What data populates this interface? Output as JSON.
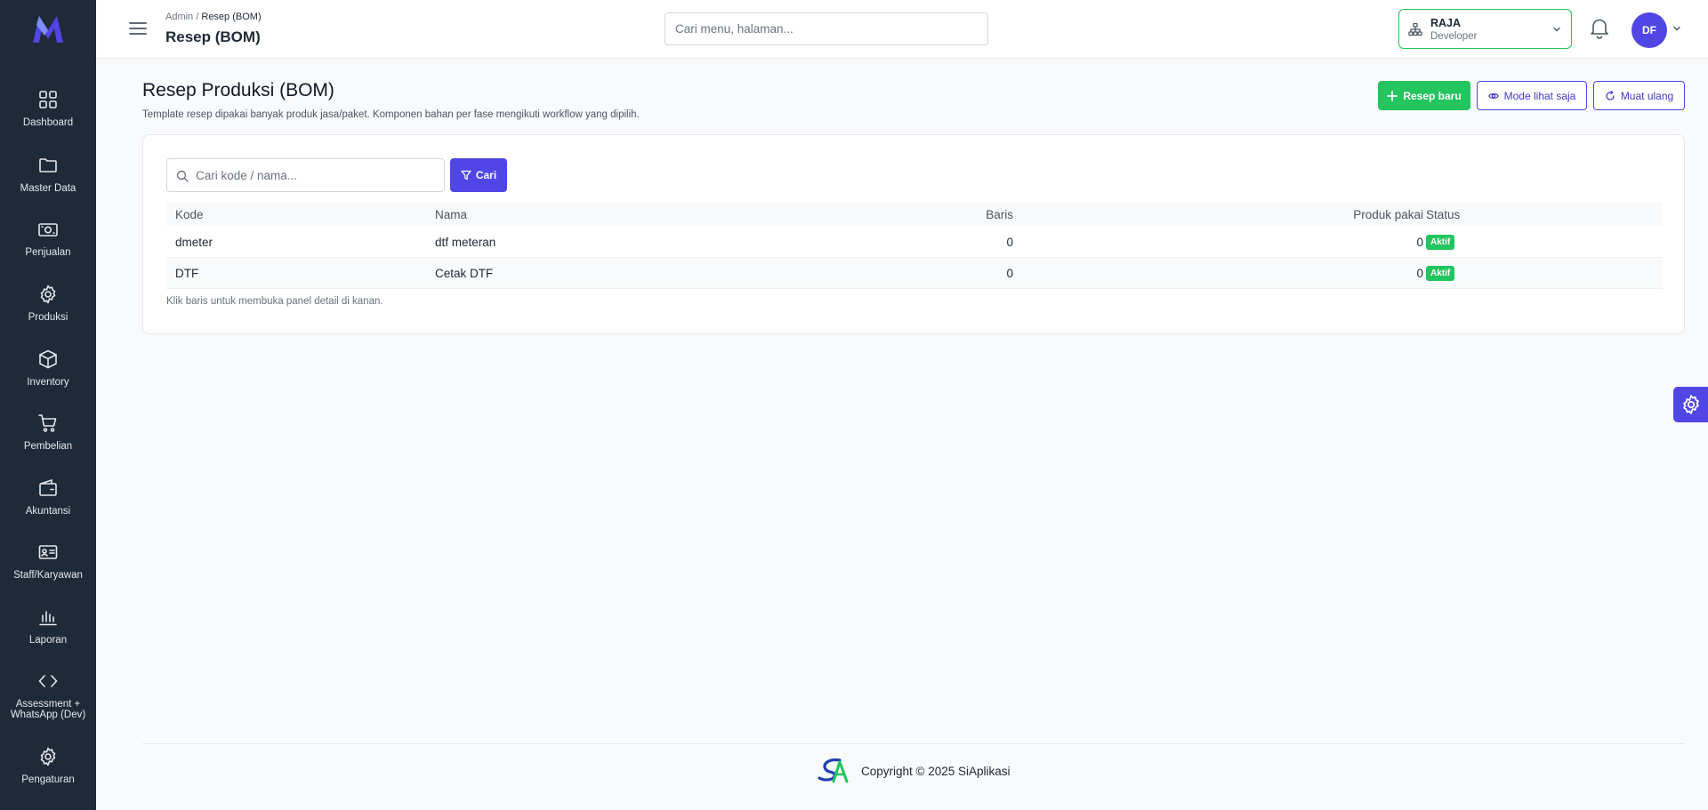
{
  "sidebar": {
    "items": [
      {
        "label": "Dashboard",
        "icon": "grid-icon"
      },
      {
        "label": "Master Data",
        "icon": "folder-icon"
      },
      {
        "label": "Penjualan",
        "icon": "cash-icon"
      },
      {
        "label": "Produksi",
        "icon": "gear-icon"
      },
      {
        "label": "Inventory",
        "icon": "box-icon"
      },
      {
        "label": "Pembelian",
        "icon": "cart-icon"
      },
      {
        "label": "Akuntansi",
        "icon": "wallet-icon"
      },
      {
        "label": "Staff/Karyawan",
        "icon": "id-card-icon"
      },
      {
        "label": "Laporan",
        "icon": "bar-chart-icon"
      },
      {
        "label": "Assessment + WhatsApp (Dev)",
        "icon": "code-icon"
      },
      {
        "label": "Pengaturan",
        "icon": "gear-icon"
      }
    ]
  },
  "header": {
    "breadcrumb_root": "Admin",
    "breadcrumb_sep": "/",
    "breadcrumb_current": "Resep (BOM)",
    "title": "Resep (BOM)",
    "search_placeholder": "Cari menu, halaman...",
    "branch_name": "RAJA",
    "branch_role": "Developer",
    "avatar_initials": "DF"
  },
  "page": {
    "title": "Resep Produksi (BOM)",
    "subtitle": "Template resep dipakai banyak produk jasa/paket. Komponen bahan per fase mengikuti workflow yang dipilih.",
    "buttons": {
      "new": "Resep baru",
      "view_only": "Mode lihat saja",
      "reload": "Muat ulang"
    }
  },
  "table": {
    "search_placeholder": "Cari kode / nama...",
    "search_button": "Cari",
    "columns": {
      "kode": "Kode",
      "nama": "Nama",
      "baris": "Baris",
      "produk": "Produk pakai",
      "status": "Status"
    },
    "rows": [
      {
        "kode": "dmeter",
        "nama": "dtf meteran",
        "baris": "0",
        "produk": "0",
        "status": "Aktif"
      },
      {
        "kode": "DTF",
        "nama": "Cetak DTF",
        "baris": "0",
        "produk": "0",
        "status": "Aktif"
      }
    ],
    "hint": "Klik baris untuk membuka panel detail di kanan."
  },
  "footer": {
    "copyright": "Copyright © 2025 SiAplikasi"
  },
  "colors": {
    "sidebar_bg": "#1e2a38",
    "primary": "#4f46e5",
    "success": "#22c55e"
  }
}
